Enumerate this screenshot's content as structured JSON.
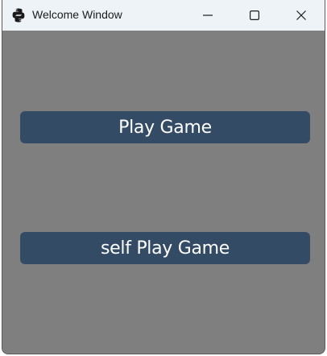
{
  "window": {
    "title": "Welcome Window",
    "app_icon": "python-icon"
  },
  "titlebar_controls": {
    "minimize_icon": "minimize-icon",
    "maximize_icon": "maximize-icon",
    "close_icon": "close-icon"
  },
  "buttons": {
    "play_label": "Play Game",
    "self_play_label": "self Play Game"
  },
  "colors": {
    "background": "#7f7f7f",
    "button_bg": "#344b65",
    "button_text": "#ffffff",
    "titlebar_bg": "#eef3f8"
  }
}
